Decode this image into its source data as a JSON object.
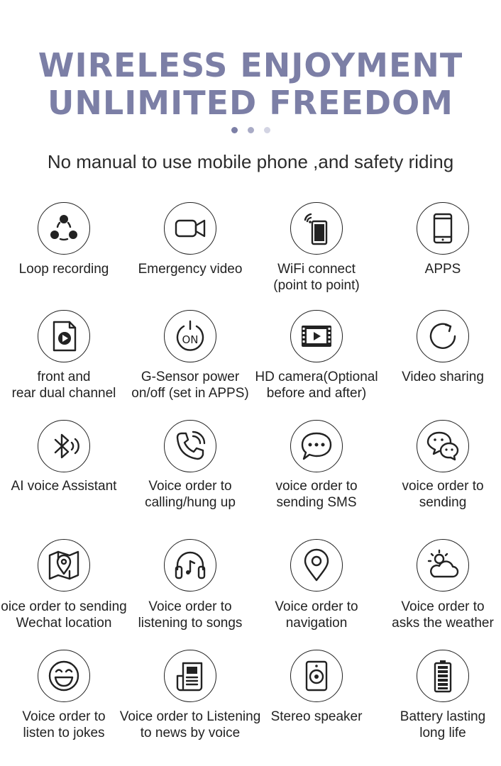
{
  "header": {
    "title_line1": "WIRELESS ENJOYMENT",
    "title_line2": "UNLIMITED FREEDOM",
    "subtitle": "No manual to use mobile phone ,and safety riding",
    "pager_colors": [
      "#7c7fa6",
      "#a9abc6",
      "#d3d4e3"
    ]
  },
  "colors": {
    "title": "#7c7fa6",
    "icon_stroke": "#222222"
  },
  "features": [
    {
      "line1": "Loop recording",
      "line2": "",
      "icon": "loop-recording-icon"
    },
    {
      "line1": "Emergency video",
      "line2": "",
      "icon": "video-camera-icon"
    },
    {
      "line1": "WiFi connect",
      "line2": "(point to point)",
      "icon": "wifi-phone-icon"
    },
    {
      "line1": "APPS",
      "line2": "",
      "icon": "phone-icon"
    },
    {
      "line1": "front and",
      "line2": "rear dual channel",
      "icon": "play-file-icon"
    },
    {
      "line1": "G-Sensor power",
      "line2": "on/off  (set in APPS)",
      "icon": "power-on-icon"
    },
    {
      "line1": "HD camera(Optional",
      "line2": "before and after)",
      "icon": "film-play-icon"
    },
    {
      "line1": "Video sharing",
      "line2": "",
      "icon": "share-arrow-icon"
    },
    {
      "line1": "AI voice Assistant",
      "line2": "",
      "icon": "bluetooth-icon"
    },
    {
      "line1": "Voice order to",
      "line2": "calling/hung up",
      "icon": "phone-call-icon"
    },
    {
      "line1": "voice order to",
      "line2": "sending SMS",
      "icon": "chat-bubble-icon"
    },
    {
      "line1": "voice order to",
      "line2": "sending",
      "icon": "wechat-icon"
    },
    {
      "line1": "oice order to sending",
      "line2": "Wechat location",
      "icon": "map-location-icon"
    },
    {
      "line1": "Voice order to",
      "line2": "listening to songs",
      "icon": "headphones-icon"
    },
    {
      "line1": "Voice order to",
      "line2": "navigation",
      "icon": "location-pin-icon"
    },
    {
      "line1": "Voice order to",
      "line2": "asks the weather",
      "icon": "weather-icon"
    },
    {
      "line1": "Voice order to",
      "line2": "listen to jokes",
      "icon": "smiley-icon"
    },
    {
      "line1": "Voice order to Listening",
      "line2": "to news by voice",
      "icon": "newspaper-icon"
    },
    {
      "line1": "Stereo speaker",
      "line2": "",
      "icon": "speaker-icon"
    },
    {
      "line1": "Battery lasting",
      "line2": "long life",
      "icon": "battery-icon"
    }
  ]
}
